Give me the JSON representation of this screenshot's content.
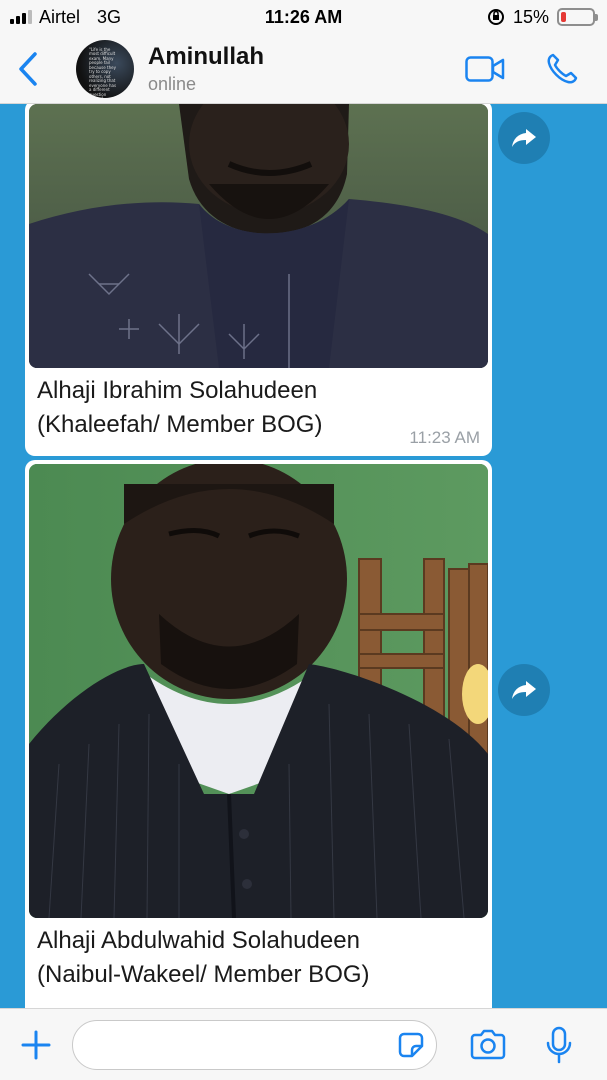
{
  "status_bar": {
    "carrier": "Airtel",
    "network": "3G",
    "time": "11:26 AM",
    "battery": "15%",
    "battery_level": 0.15,
    "battery_color": "#e53935"
  },
  "header": {
    "contact_name": "Aminullah",
    "contact_status": "online",
    "avatar_quote": "\"Life is the most difficult exam. Many people fail because they try to copy others, not realizing that everyone has a different question paper.\"",
    "icons": [
      "back-icon",
      "video-call-icon",
      "phone-icon"
    ]
  },
  "messages": [
    {
      "type": "image",
      "caption_line1": "Alhaji Ibrahim Solahudeen",
      "caption_line2": "(Khaleefah/ Member BOG)",
      "time": "11:23 AM"
    },
    {
      "type": "image",
      "caption_line1": "Alhaji Abdulwahid Solahudeen",
      "caption_line2": "(Naibul-Wakeel/ Member BOG)"
    }
  ],
  "composer": {
    "placeholder": "",
    "icons": [
      "plus-icon",
      "sticker-icon",
      "camera-icon",
      "microphone-icon"
    ]
  },
  "colors": {
    "accent": "#1a84f0",
    "chat_background": "#2a9ad6",
    "forward_button": "#1f7fb3"
  }
}
